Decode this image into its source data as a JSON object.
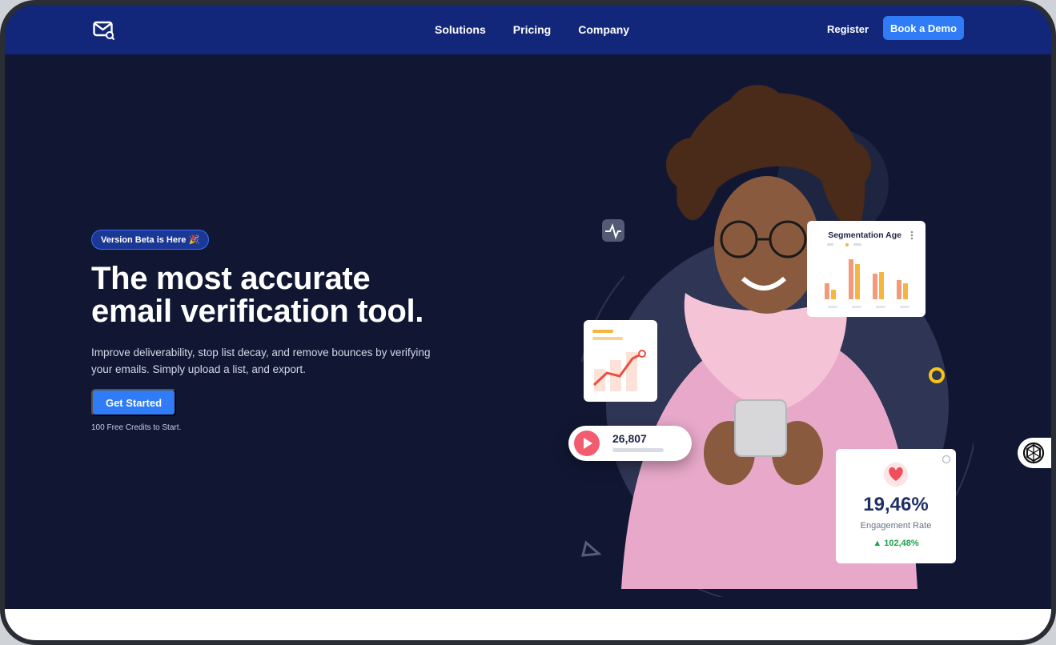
{
  "nav": {
    "logo_icon": "mail-search-icon",
    "links": [
      "Solutions",
      "Pricing",
      "Company"
    ],
    "register": "Register",
    "demo": "Book a Demo"
  },
  "hero": {
    "badge": "Version Beta is Here 🎉",
    "headline_line1": "The most accurate",
    "headline_line2": "email verification tool.",
    "subtext_line1": "Improve deliverability, stop list decay, and remove bounces by verifying",
    "subtext_line2": "your emails. Simply upload a list, and export.",
    "cta": "Get Started",
    "credits": "100 Free Credits to Start."
  },
  "visual": {
    "segmentation_title": "Segmentation Age",
    "counter_value": "26,807",
    "engagement_value": "19,46%",
    "engagement_label": "Engagement Rate",
    "engagement_change": "▲ 102,48%"
  },
  "colors": {
    "nav_bg": "#13277a",
    "hero_bg": "#111733",
    "accent": "#2f7cf6",
    "positive": "#1aa24a"
  }
}
